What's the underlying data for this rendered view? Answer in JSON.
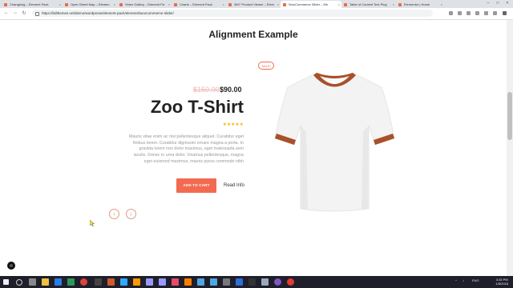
{
  "browser": {
    "tabs": [
      {
        "label": "Changelog – Element Pack"
      },
      {
        "label": "Open Street Map – Elemen"
      },
      {
        "label": "Video Gallery – Element Pa"
      },
      {
        "label": "Charts – Element Pack"
      },
      {
        "label": "360° Product Viewer – Elem"
      },
      {
        "label": "WooCommerce Slider – Ele"
      },
      {
        "label": "Table of Content Text Plug"
      },
      {
        "label": "Elementor | Home"
      }
    ],
    "url": "https://bdthemes.net/demo/wordpress/element-pack/element/woocommerce-slider/"
  },
  "page": {
    "section_title": "Alignment Example",
    "product": {
      "badge": "SALE!",
      "old_price": "$150.00",
      "new_price": "$90.00",
      "name": "Zoo T-Shirt",
      "rating_stars": "★★★★★",
      "description": "Mauris vitae enim ac nisi pellentesque aliquet. Curabitur eget finibus lorem. Curabitur dignissim ornare magna a porta. In gravida lorem non dolor maximus, eget malesuada sem iaculis. Donec in urna dolor. Vivamus pellentesque, magna eget euismod maximus, mauris purus commodo nibh",
      "add_to_cart_label": "ADD TO CART",
      "read_info_label": "Read Info",
      "colors": {
        "accent": "#f26b51",
        "shirt_trim": "#a9502a"
      }
    },
    "slider_nav": {
      "prev": "‹",
      "next": "›"
    }
  },
  "taskbar": {
    "language": "ENG",
    "time": "3:33 PM",
    "date": "1/8/2018"
  }
}
